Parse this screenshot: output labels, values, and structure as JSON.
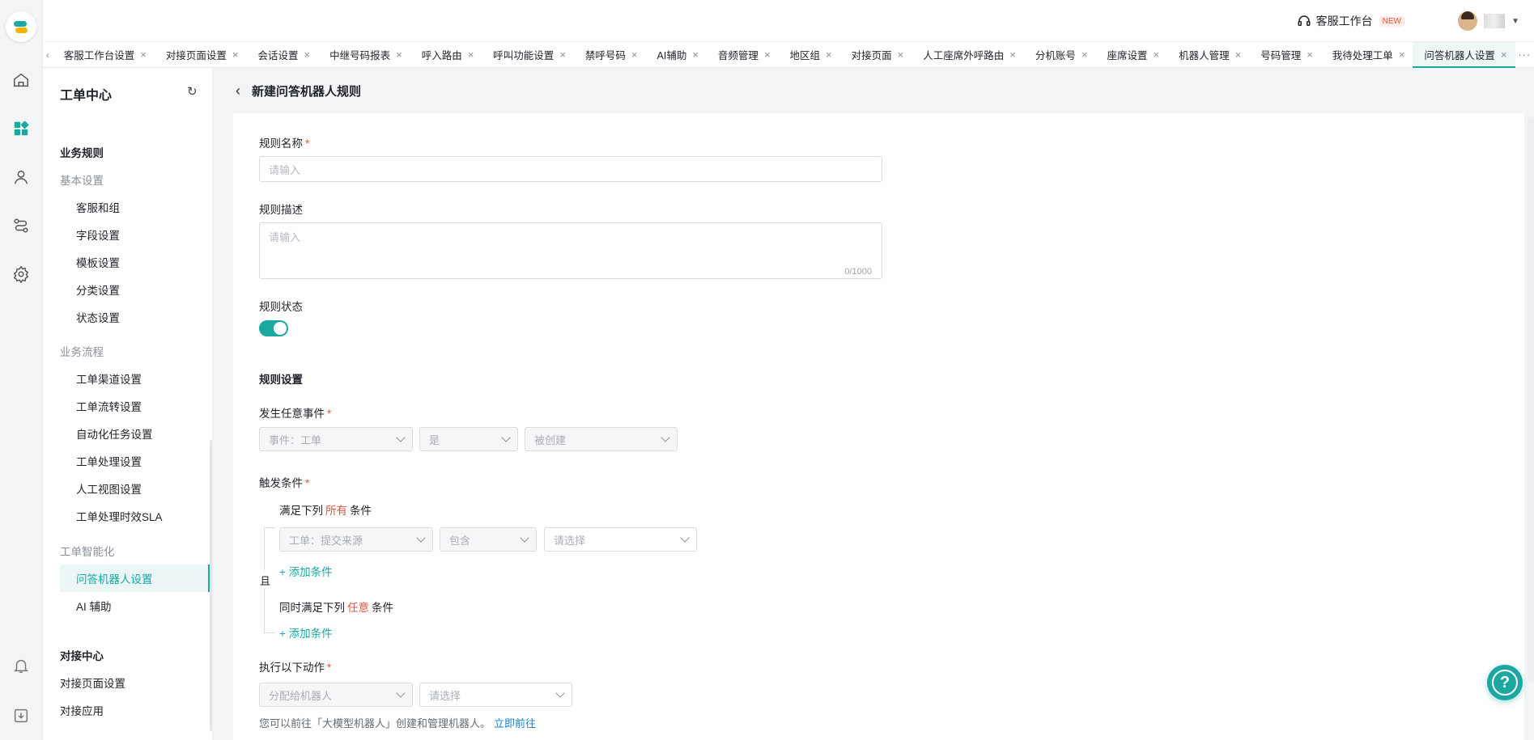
{
  "topbar": {
    "workspace_label": "客服工作台",
    "new_badge": "NEW"
  },
  "tabs": [
    {
      "label": "客服工作台设置",
      "active": false
    },
    {
      "label": "对接页面设置",
      "active": false
    },
    {
      "label": "会话设置",
      "active": false
    },
    {
      "label": "中继号码报表",
      "active": false
    },
    {
      "label": "呼入路由",
      "active": false
    },
    {
      "label": "呼叫功能设置",
      "active": false
    },
    {
      "label": "禁呼号码",
      "active": false
    },
    {
      "label": "AI辅助",
      "active": false
    },
    {
      "label": "音频管理",
      "active": false
    },
    {
      "label": "地区组",
      "active": false
    },
    {
      "label": "对接页面",
      "active": false
    },
    {
      "label": "人工座席外呼路由",
      "active": false
    },
    {
      "label": "分机账号",
      "active": false
    },
    {
      "label": "座席设置",
      "active": false
    },
    {
      "label": "机器人管理",
      "active": false
    },
    {
      "label": "号码管理",
      "active": false
    },
    {
      "label": "我待处理工单",
      "active": false
    },
    {
      "label": "问答机器人设置",
      "active": true
    }
  ],
  "sidemenu": {
    "title": "工单中心",
    "section_business_rules": "业务规则",
    "group_basic": "基本设置",
    "basic_items": [
      "客服和组",
      "字段设置",
      "模板设置",
      "分类设置",
      "状态设置"
    ],
    "group_flow": "业务流程",
    "flow_items": [
      "工单渠道设置",
      "工单流转设置",
      "自动化任务设置",
      "工单处理设置",
      "人工视图设置",
      "工单处理时效SLA"
    ],
    "group_ai": "工单智能化",
    "ai_items": [
      "问答机器人设置",
      "AI 辅助"
    ],
    "section_integration": "对接中心",
    "integration_items": [
      "对接页面设置",
      "对接应用"
    ]
  },
  "page": {
    "title": "新建问答机器人规则",
    "rule_name_label": "规则名称",
    "rule_name_placeholder": "请输入",
    "rule_desc_label": "规则描述",
    "rule_desc_placeholder": "请输入",
    "rule_desc_counter": "0/1000",
    "rule_status_label": "规则状态",
    "rule_status_on": true,
    "rule_settings_title": "规则设置",
    "event_label": "发生任意事件",
    "event_selects": [
      "事件：工单",
      "是",
      "被创建"
    ],
    "trigger_label": "触发条件",
    "and_label": "且",
    "cond_all_prefix": "满足下列",
    "cond_all_em": "所有",
    "cond_all_suffix": "条件",
    "cond_all_selects": [
      "工单：提交来源",
      "包含",
      "请选择"
    ],
    "add_condition": "添加条件",
    "cond_any_prefix": "同时满足下列",
    "cond_any_em": "任意",
    "cond_any_suffix": "条件",
    "action_label": "执行以下动作",
    "action_selects": [
      "分配给机器人",
      "请选择"
    ],
    "hint_text": "您可以前往「大模型机器人」创建和管理机器人。",
    "hint_link": "立即前往"
  },
  "colors": {
    "accent": "#1aa8a0",
    "required": "#e5533d",
    "link": "#1a7fd1"
  }
}
